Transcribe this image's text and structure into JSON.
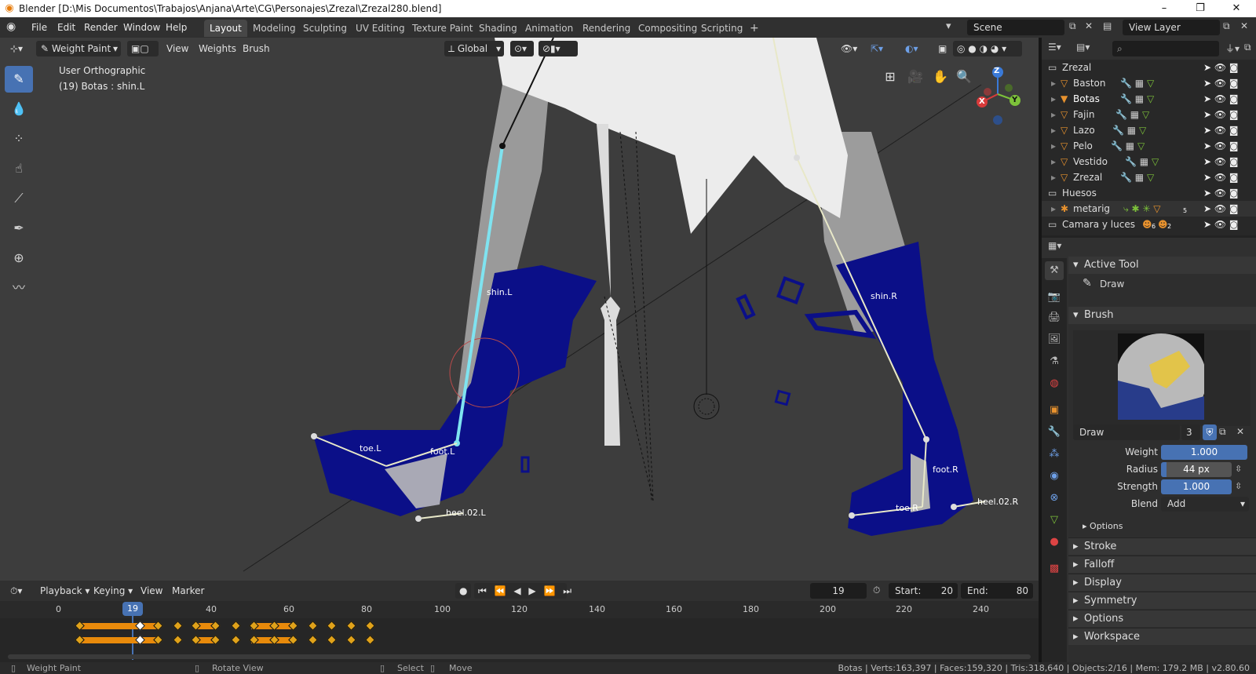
{
  "window": {
    "title": "Blender [D:\\Mis Documentos\\Trabajos\\Anjana\\Arte\\CG\\Personajes\\Zrezal\\Zrezal280.blend]",
    "minimize": "–",
    "maximize": "❐",
    "close": "✕"
  },
  "menubar": {
    "items": [
      "File",
      "Edit",
      "Render",
      "Window",
      "Help"
    ]
  },
  "workspaces": {
    "tabs": [
      "Layout",
      "Modeling",
      "Sculpting",
      "UV Editing",
      "Texture Paint",
      "Shading",
      "Animation",
      "Rendering",
      "Compositing",
      "Scripting"
    ],
    "active": "Layout",
    "add": "+"
  },
  "scene": {
    "name": "Scene"
  },
  "view_layer": {
    "name": "View Layer"
  },
  "viewport_header": {
    "mode": "Weight Paint",
    "menus": [
      "View",
      "Weights",
      "Brush"
    ],
    "orientation": "Global"
  },
  "viewport": {
    "view_name": "User Orthographic",
    "object_info": "(19) Botas : shin.L",
    "bones": [
      "shin.L",
      "toe.L",
      "foot.L",
      "heel.02.L",
      "shin.R",
      "foot.R",
      "toe.R",
      "heel.02.R"
    ],
    "gizmo": {
      "x": "X",
      "y": "Y",
      "z": "Z"
    }
  },
  "outliner": {
    "search_placeholder": "",
    "rows": [
      {
        "name": "Zrezal",
        "type": "collection"
      },
      {
        "name": "Baston",
        "type": "object"
      },
      {
        "name": "Botas",
        "type": "object"
      },
      {
        "name": "Fajin",
        "type": "object"
      },
      {
        "name": "Lazo",
        "type": "object"
      },
      {
        "name": "Pelo",
        "type": "object"
      },
      {
        "name": "Vestido",
        "type": "object"
      },
      {
        "name": "Zrezal",
        "type": "object"
      },
      {
        "name": "Huesos",
        "type": "collection"
      },
      {
        "name": "metarig",
        "type": "armature"
      },
      {
        "name": "Camara y luces",
        "type": "collection"
      }
    ],
    "badges": {
      "metarig": "5",
      "camera_count": "6",
      "light_count": "2"
    }
  },
  "properties": {
    "active_tool_header": "Active Tool",
    "active_tool_name": "Draw",
    "brush_header": "Brush",
    "brush_name": "Draw",
    "brush_users": "3",
    "weight_label": "Weight",
    "weight_value": "1.000",
    "radius_label": "Radius",
    "radius_value": "44 px",
    "strength_label": "Strength",
    "strength_value": "1.000",
    "blend_label": "Blend",
    "blend_value": "Add",
    "options_sub": "Options",
    "sections": [
      "Stroke",
      "Falloff",
      "Display",
      "Symmetry",
      "Options",
      "Workspace"
    ]
  },
  "timeline": {
    "menus": [
      "Playback",
      "Keying",
      "View",
      "Marker"
    ],
    "current_frame": "19",
    "start_label": "Start:",
    "start": "20",
    "end_label": "End:",
    "end": "80",
    "ruler": [
      "0",
      "19",
      "40",
      "60",
      "80",
      "100",
      "120",
      "140",
      "160",
      "180",
      "200",
      "220",
      "240"
    ]
  },
  "statusbar": {
    "left_action": "Weight Paint",
    "mid_action": "Rotate View",
    "select": "Select",
    "move": "Move",
    "stats": "Botas | Verts:163,397 | Faces:159,320 | Tris:318,640 | Objects:2/16 | Mem: 179.2 MB | v2.80.60"
  },
  "colors": {
    "accent": "#4772b3",
    "boots": "#0b0f88",
    "selected_bone": "#7fe3f0",
    "keyframe": "#e0a21a"
  }
}
